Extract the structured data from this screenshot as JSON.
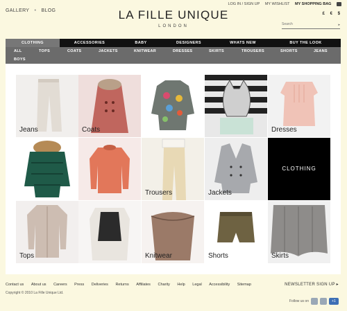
{
  "header": {
    "left_links": [
      "GALLERY",
      "BLOG"
    ],
    "separator": "•",
    "logo_name": "LA FILLE UNIQUE",
    "logo_city": "LONDON",
    "account_links": [
      "LOG IN / SIGN UP",
      "MY WISHLIST",
      "MY SHOPPING BAG"
    ],
    "currencies": [
      "£",
      "€",
      "$"
    ],
    "search_placeholder": "Search",
    "search_arrow": "▸"
  },
  "nav_primary": [
    {
      "label": "CLOTHING",
      "active": true
    },
    {
      "label": "ACCESSORIES",
      "active": false
    },
    {
      "label": "BABY",
      "active": false
    },
    {
      "label": "DESIGNERS",
      "active": false
    },
    {
      "label": "WHATS  NEW",
      "active": false
    },
    {
      "label": "BUY THE LOOK",
      "active": false
    }
  ],
  "nav_secondary": [
    "ALL",
    "TOPS",
    "COATS",
    "JACKETS",
    "KNITWEAR",
    "DRESSES",
    "SKIRTS",
    "TROUSERS",
    "SHORTS",
    "JEANS",
    "BOYS"
  ],
  "tiles": [
    {
      "label": "Jeans",
      "bg": "#f1efed",
      "img": "jeans-photo"
    },
    {
      "label": "Coats",
      "bg": "#efdedc",
      "img": "coat-photo"
    },
    {
      "label": "",
      "bg": "#ffffff",
      "img": "cardigan-photo"
    },
    {
      "label": "",
      "bg": "#e8e8e8",
      "img": "cat-print-photo"
    },
    {
      "label": "Dresses",
      "bg": "#f2f2f2",
      "img": "dress-photo"
    },
    {
      "label": "",
      "bg": "#ffffff",
      "img": "puffer-jacket-photo"
    },
    {
      "label": "",
      "bg": "#f6eae8",
      "img": "knit-top-photo"
    },
    {
      "label": "Trousers",
      "bg": "#f3f0e8",
      "img": "trousers-photo"
    },
    {
      "label": "Jackets",
      "bg": "#eeeeee",
      "img": "jacket-photo"
    },
    {
      "label": "CLOTHING",
      "bg": "#000000",
      "img": ""
    },
    {
      "label": "Tops",
      "bg": "#f2efee",
      "img": "tops-photo"
    },
    {
      "label": "",
      "bg": "#f7f5f4",
      "img": "vest-blouse-photo"
    },
    {
      "label": "Knitwear",
      "bg": "#f6f2f0",
      "img": "knitwear-photo"
    },
    {
      "label": "Shorts",
      "bg": "#ffffff",
      "img": "shorts-photo"
    },
    {
      "label": "Skirts",
      "bg": "#f0f0f0",
      "img": "skirt-photo"
    }
  ],
  "footer": {
    "links": [
      "Contact us",
      "About us",
      "Careers",
      "Press",
      "Deliveries",
      "Returns",
      "Affiliates",
      "Charity",
      "Help",
      "Legal",
      "Accessibility",
      "Sitemap"
    ],
    "copyright": "Copyright © 2010 La Fille Unique Ltd.",
    "newsletter": "NEWSLETTER SIGN UP ▸",
    "follow": "Follow us on",
    "social_plus": "+1"
  },
  "colors": {
    "page_bg": "#fbf8e0",
    "nav_primary_bg": "#111111",
    "nav_active_bg": "#777777",
    "nav_secondary_bg": "#6b6b6b"
  }
}
